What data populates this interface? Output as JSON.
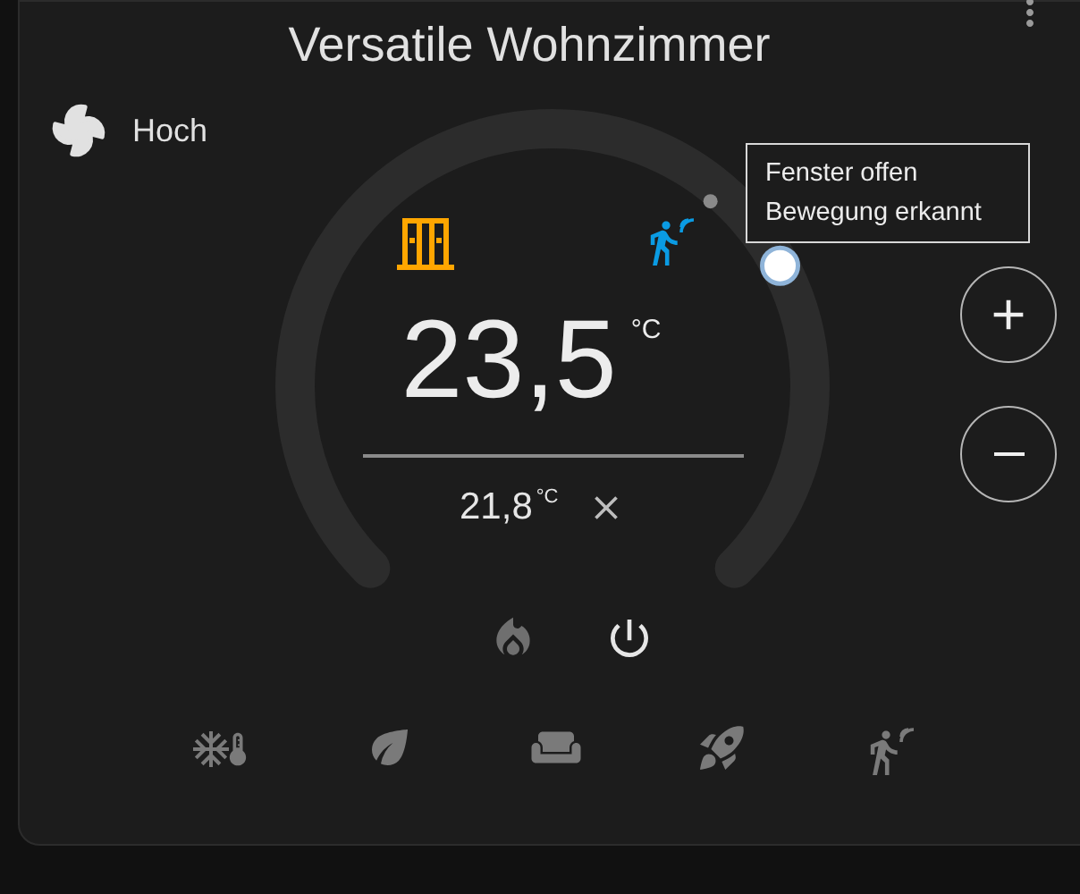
{
  "title": "Versatile Wohnzimmer",
  "fan_mode": {
    "label": "Hoch"
  },
  "status_icons": [
    {
      "kind": "window",
      "color": "#ffa600"
    },
    {
      "kind": "motion",
      "color": "#0a9be3"
    }
  ],
  "tooltip": {
    "lines": [
      "Fenster offen",
      "Bewegung erkannt"
    ]
  },
  "setpoint": {
    "value": "23,5",
    "unit": "°C"
  },
  "current": {
    "value": "21,8",
    "unit": "°C"
  },
  "hvac_modes": [
    {
      "kind": "heat",
      "selected": false
    },
    {
      "kind": "off",
      "selected": true
    }
  ],
  "presets": [
    {
      "kind": "frost",
      "selected": false
    },
    {
      "kind": "eco",
      "selected": false
    },
    {
      "kind": "comfort",
      "selected": false
    },
    {
      "kind": "boost",
      "selected": false
    },
    {
      "kind": "presence",
      "selected": false
    }
  ]
}
